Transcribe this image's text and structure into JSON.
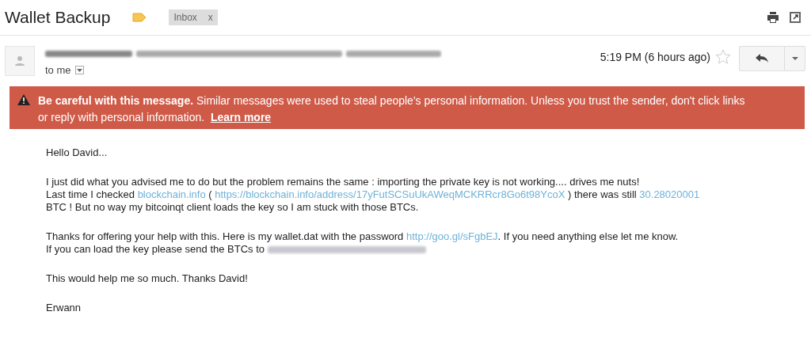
{
  "subject": "Wallet Backup",
  "label": {
    "text": "Inbox",
    "close": "x"
  },
  "message": {
    "recipient": "to me",
    "time": "5:19 PM (6 hours ago)",
    "starred": false
  },
  "warning": {
    "title": "Be careful with this message.",
    "text": "Similar messages were used to steal people's personal information. Unless you trust the sender, don't click links or reply with personal information.",
    "link": "Learn more"
  },
  "paragraphs": [
    [
      [
        {
          "kind": "text",
          "text": "Hello David..."
        }
      ]
    ],
    [
      [
        {
          "kind": "text",
          "text": "I just did what you advised me to do but the problem remains the same : importing the private key is not working.... drives me nuts!"
        }
      ],
      [
        {
          "kind": "text",
          "text": "Last time I checked "
        },
        {
          "kind": "link",
          "text": "blockchain.info"
        },
        {
          "kind": "text",
          "text": " ( "
        },
        {
          "kind": "link",
          "text": "https://blockchain.info/address/17yFutSCSuUkAWeqMCKRRcr8Go6t98YcoX"
        },
        {
          "kind": "text",
          "text": " ) there was still "
        },
        {
          "kind": "link",
          "text": "30.28020001"
        }
      ],
      [
        {
          "kind": "text",
          "text": "BTC ! But no way my bitcoinqt client loads the key so I am stuck with those BTCs."
        }
      ]
    ],
    [
      [
        {
          "kind": "text",
          "text": "Thanks for offering your help with this. Here is my wallet.dat with the password "
        },
        {
          "kind": "link",
          "text": "http://goo.gl/sFgbEJ"
        },
        {
          "kind": "text",
          "text": ". If you need anything else let me know."
        }
      ],
      [
        {
          "kind": "text",
          "text": "If you can load the key please send the BTCs to "
        },
        {
          "kind": "redacted"
        }
      ]
    ],
    [
      [
        {
          "kind": "text",
          "text": "This would help me so much. Thanks David!"
        }
      ]
    ],
    [
      [
        {
          "kind": "text",
          "text": "Erwann"
        }
      ]
    ]
  ]
}
